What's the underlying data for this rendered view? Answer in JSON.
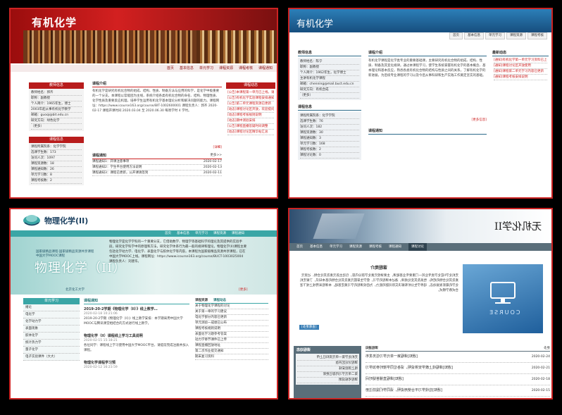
{
  "p1": {
    "title": "有机化学",
    "nav": [
      "首页",
      "基本信息",
      "单元学习",
      "课程资源",
      "课程考核",
      "课程通知"
    ],
    "teacher_head": "教师信息",
    "teacher_lines": [
      "教师姓名：郭齐",
      "职称：副教授",
      "个人简介：1965年生，博士",
      "2003年起从事有机化学教学",
      "邮箱：guoqi@bit.edu.cn",
      "研究方向：绿色化学",
      "（更多）"
    ],
    "course_head": "课程信息",
    "course_lines": [
      "课程所属院系：化学学院",
      "选课学生数：173",
      "访问人次：1097",
      "课程资源数：18",
      "课程通知数：26",
      "单元学习数：8",
      "课程考核数：2"
    ],
    "intro_title": "课程介绍",
    "intro_text": "有机化学是研究有机化合物的组成、结构、性质、制备方法与应用的科学，是化学中极重要的一个分支。本课程以官能团为主线，系统介绍各类有机化合物的命名、结构、物理性质、化学性质及重要反应机理，培养学生运用有机化学基本理论分析和解决问题的能力。课程网址：https://www.icourse163.org/course/BIT-1002600001 课程负责人：郭齐 2020-02-17 课程开课时间 2020.03.04 至 2020.06.30 每周学时 4 学时。",
    "more": "[详细]",
    "notice_title": "课程通知",
    "notice_more": "更多>>",
    "notices": [
      {
        "t": "课程通知1：开课注意事项",
        "d": "2020-02-17"
      },
      {
        "t": "课程通知2：学生平台使用方法说明",
        "d": "2020-02-13"
      },
      {
        "t": "课程通知3：课程已更新，公开课请签到",
        "d": "2020-02-11"
      }
    ],
    "news_head": "课程动态",
    "news": [
      "[公告]本课程第一单元已上线，请各位同学按时学习",
      "[公告]有机化学实验课程安排通知",
      "[公告]第二单元课程资源已更新",
      "[动态]课程讨论区开放，欢迎提问",
      "[动态]课程考核规则说明",
      "[动态]期中测验安排",
      "[公告]课程直播答疑时间调整",
      "[动态]课程讨论区精华帖汇总"
    ]
  },
  "p2": {
    "title": "有机化学",
    "nav": [
      "首页",
      "基本信息",
      "单元学习",
      "课程资源",
      "课程考核"
    ],
    "teacher_head": "教师信息",
    "teacher_lines": [
      "教师姓名：陈宁",
      "职称：副教授",
      "个人简介：1962年生，化学博士",
      "主讲有机化学课程",
      "邮箱：chenning@mail.buct.edu.cn",
      "研究方向：有机合成",
      "（更多）"
    ],
    "course_head": "课程信息",
    "course_lines": [
      "课程所属院系：化学学院",
      "选课学生数：76",
      "访问人次：182",
      "课程资源数：30",
      "课程通知数：3",
      "单元学习数：168",
      "课程考核数：2",
      "课程讨论数：0"
    ],
    "intro_title": "课程介绍",
    "intro_text": "有机化学课程是化学类专业的重要基础课，主要研究有机化合物的组成、结构、性质、制备及其变化规律。通过本课程学习，使学生系统掌握有机化学的基本概念、基本理论和基本反应，熟悉各类有机化合物的结构与性质之间的关系，了解有机化学的新进展，为后续专业课程的学习以及今后从事科研和生产实践工作奠定坚实的基础。",
    "more": "[更多信息]",
    "notice_title": "课程通知",
    "news_head": "最新动态",
    "news": [
      "[通知]有机化学第一单元学习资料已上传",
      "[通知]课程讨论区开放使用",
      "[通知]课程第二单元学习内容已更新",
      "[通知]课程考核安排说明"
    ]
  },
  "p3": {
    "title": "物理化学(II)",
    "nav": [
      "首页",
      "基本信息",
      "单元学习",
      "课程资源",
      "课程通知"
    ],
    "banner_sub": "国家级精品课程·国家级精品资源共享课程\n中国大学MOOC课程",
    "banner_title": "物理化学（II）",
    "banner_school": "北京化工大学",
    "intro_text": "物理化学是化学学科的一个重要分支，它借助数学、物理学等基础科学的理论及其提供的实验手段，研究化学科学中的原理和方法，研究化学体系行为最一般的规律和理论。物理化学(II)课程主要包括化学动力学、电化学、表面化学与胶体化学等内容。本课程为国家级精品资源共享课程，已在中国大学MOOC上线。课程网址：https://www.icourse163.org/course/BUCT-1003025004 课程负责人：刘建华。",
    "more": "[更多]",
    "unit_head": "单元学习",
    "units": [
      "绪论",
      "电化学",
      "化学动力学",
      "表面现象",
      "胶体化学",
      "统计热力学",
      "量子化学",
      "电子实验课件（大大）"
    ],
    "notice_tab": "课程通知",
    "notices": [
      {
        "t": "2019-20-2学期《物理化学（II）》线上教学…",
        "d": "2020-02-18 10:21:06",
        "x": "2019-20-2学期《物理化学（II）》线上教学安排：本学期采用中国大学MOOC与腾讯课堂相结合的方式进行线上教学。"
      },
      {
        "t": "物理化学（II）课程线上学习工具说明",
        "d": "2020-02-15 15:18:21",
        "x": "各位同学：课程线上学习使用中国大学MOOC平台，请提前完成注册并加入课程。"
      },
      {
        "t": "物理化学课程学习预",
        "d": "2020-02-12 16:23:59",
        "x": ""
      }
    ],
    "news_tabs": [
      "课程资源",
      "课程动态"
    ],
    "news": [
      "关于物理化学课程的讨论",
      "关于第一章的学习建议",
      "电化学部分内容已更新",
      "单元测验一成绩已公布",
      "课程考核规则说明",
      "表面化学习题参考答案",
      "动力学章节课件已上传",
      "课程直播回放地址",
      "第二次作业提交通知",
      "期末复习资料"
    ]
  },
  "p4": {
    "title": "无机化学II",
    "nav": [
      "首页",
      "基本信息",
      "单元学习",
      "课程资源",
      "课程考核",
      "课程通知",
      "课程讨论"
    ],
    "intro_title": "课程简介",
    "intro_text": "无机化学II是化学类专业的一门重要专业基础课，主要讲授元素化学部分内容，包括主族元素及其化合物、过渡元素及其化合物的结构、性质及其变化规律。通过本课程的学习，使学生掌握元素及其化合物的基本知识，了解无机化学的最新发展动态，培养学生分析和解决实际问题的能力，为后续课程的学习奠定基础。本课程采用线上线下混合式教学模式。",
    "more": "[查看更多]",
    "image_word": "COURSE",
    "notice_title": "课程通知",
    "notice_more": "更多",
    "news_head": "课程动态",
    "news": [
      "无机化学第一单元资料已上传",
      "课程讨论区开放",
      "线上测验安排",
      "第二单元学习内容已更新",
      "课程考核说明"
    ],
    "notices": [
      {
        "t": "[通知]课程第一单元学习任务发布",
        "d": "2020-02-24"
      },
      {
        "t": "[通知]课程线上教学安排说明，请各位同学按时参加学习",
        "d": "2020-02-21"
      },
      {
        "t": "[通知]课程直播答疑时间",
        "d": "2020-02-18"
      },
      {
        "t": "[通知]在线学习平台使用说明，请同学们提前注册",
        "d": "2020-02-15"
      }
    ]
  }
}
